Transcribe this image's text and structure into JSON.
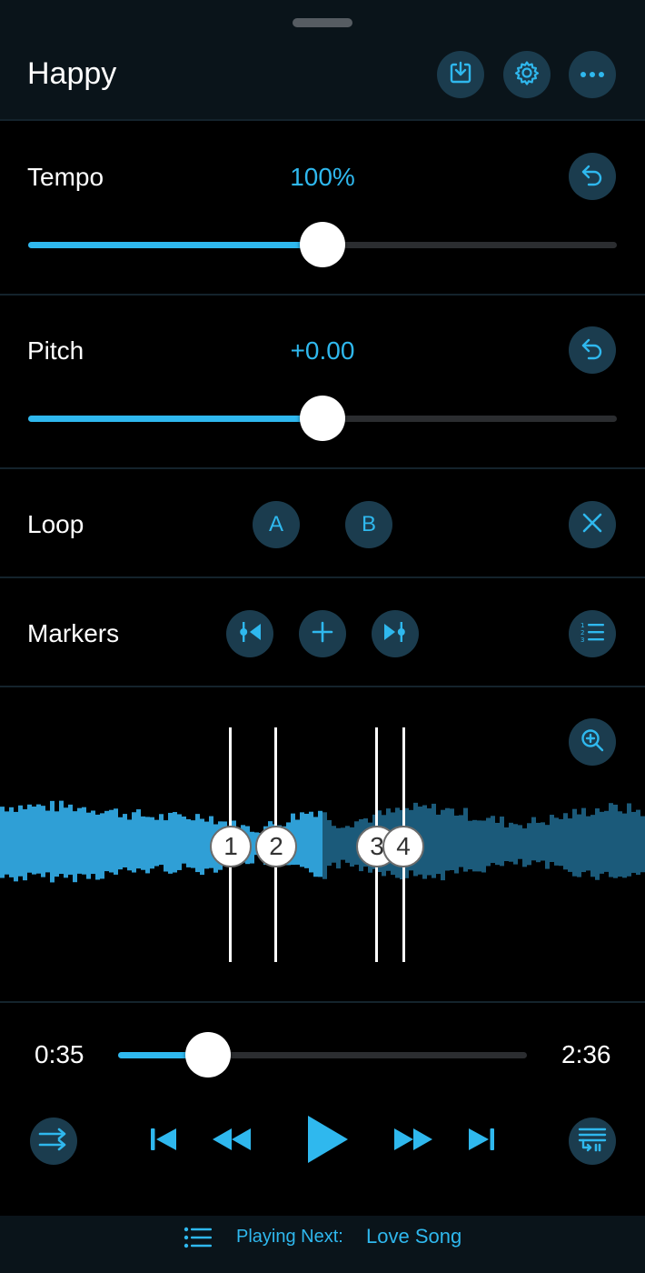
{
  "colors": {
    "accent": "#2fb8ee",
    "button_bg": "#1b3c4e",
    "header_bg": "#0a141a",
    "wave_played": "#2f9fd6",
    "wave_unplayed": "#1b5a7a"
  },
  "header": {
    "title": "Happy",
    "buttons": [
      {
        "name": "download-icon"
      },
      {
        "name": "gear-icon"
      },
      {
        "name": "more-icon"
      }
    ]
  },
  "tempo": {
    "label": "Tempo",
    "value": "100%",
    "slider_fraction": 0.5,
    "reset_icon": "undo-icon"
  },
  "pitch": {
    "label": "Pitch",
    "value": "+0.00",
    "slider_fraction": 0.5,
    "reset_icon": "undo-icon"
  },
  "loop": {
    "label": "Loop",
    "a_label": "A",
    "b_label": "B",
    "clear_icon": "close-icon"
  },
  "markers": {
    "label": "Markers",
    "prev_icon": "previous-marker-icon",
    "add_icon": "plus-icon",
    "next_icon": "next-marker-icon",
    "list_icon": "numbered-list-icon"
  },
  "waveform": {
    "zoom_icon": "zoom-in-icon",
    "markers": [
      "1",
      "2",
      "3",
      "4"
    ]
  },
  "playback": {
    "elapsed": "0:35",
    "total": "2:36",
    "progress_fraction": 0.22,
    "controls": [
      "shuffle-icon",
      "skip-back-icon",
      "rewind-icon",
      "play-icon",
      "fast-forward-icon",
      "skip-forward-icon",
      "queue-icon"
    ]
  },
  "footer": {
    "playing_next_label": "Playing Next:",
    "next_song": "Love Song"
  }
}
